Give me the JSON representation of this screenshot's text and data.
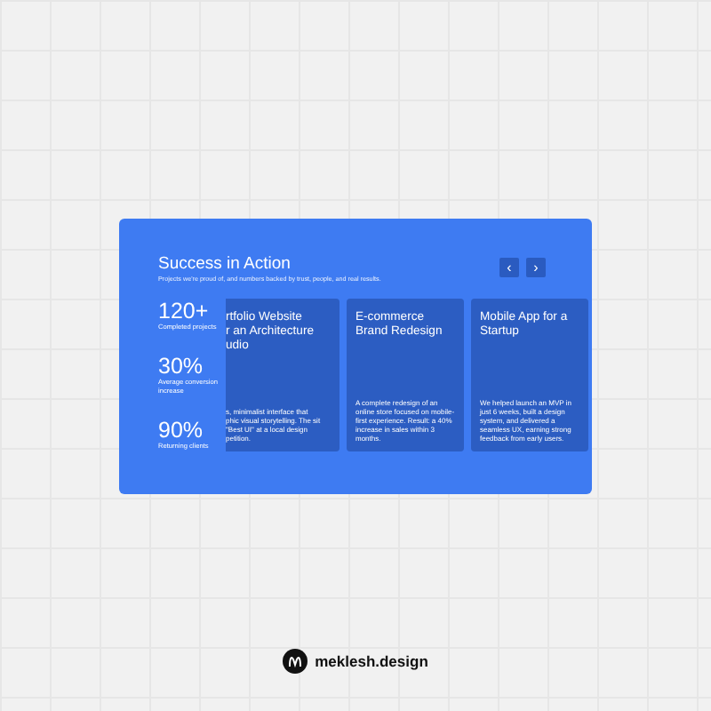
{
  "section": {
    "title": "Success in Action",
    "subtitle": "Projects we're proud of, and numbers backed by trust, people, and real results.",
    "nav_buttons": [
      {
        "symbol": "‹",
        "disabled": false
      },
      {
        "symbol": "›",
        "disabled": false
      }
    ],
    "stats": [
      {
        "value": "120+",
        "label": "Completed projects"
      },
      {
        "value": "30%",
        "label": "Average conversion increase"
      },
      {
        "value": "90%",
        "label": "Returning clients"
      }
    ],
    "cards": [
      {
        "kind": "cut",
        "title_lines": [
          "rtfolio Website",
          "r an Architecture",
          "udio"
        ],
        "description_lines": [
          "s, minimalist interface that",
          "phic visual storytelling. The sit",
          "\"Best UI\" at a local design",
          "petition."
        ]
      },
      {
        "kind": "full",
        "title_lines": [
          "E-commerce",
          "Brand Redesign"
        ],
        "description": "A complete redesign of an online store focused on mobile-first experience. Result: a 40% increase in sales within 3 months."
      },
      {
        "kind": "full",
        "title_lines": [
          "Mobile App for a",
          "Startup"
        ],
        "description": "We helped launch an MVP in just 6 weeks, built a design system, and delivered a seamless UX, earning strong feedback from early users."
      }
    ]
  },
  "brand": {
    "name": "meklesh.design"
  }
}
